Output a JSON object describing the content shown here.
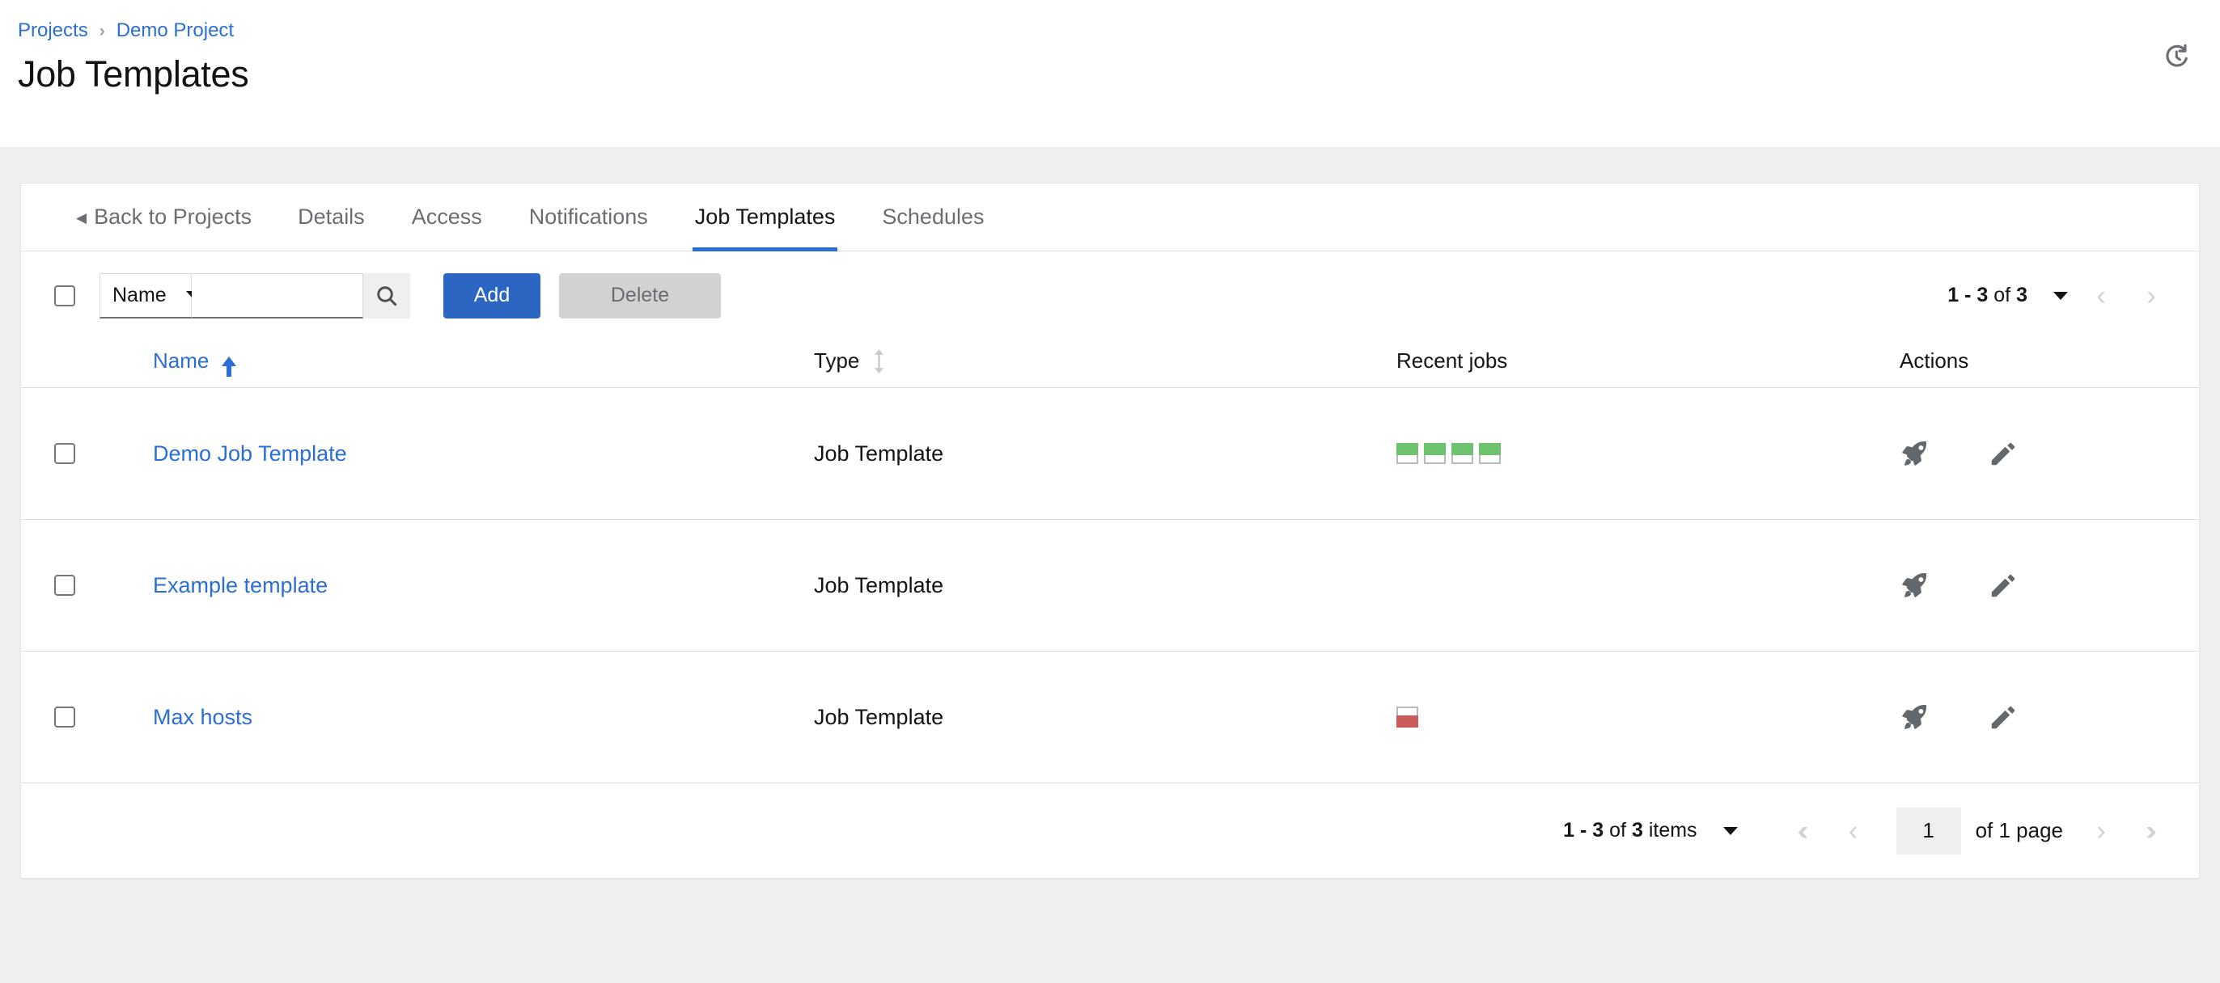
{
  "header": {
    "breadcrumb": [
      {
        "label": "Projects",
        "icon": ""
      },
      {
        "label": "Demo Project",
        "icon": ""
      }
    ],
    "breadcrumb_separator": "›",
    "title": "Job Templates",
    "history_icon": "history-icon"
  },
  "tabs": [
    {
      "label": "Back to Projects",
      "icon": "back-caret-icon",
      "active": false
    },
    {
      "label": "Details",
      "active": false
    },
    {
      "label": "Access",
      "active": false
    },
    {
      "label": "Notifications",
      "active": false
    },
    {
      "label": "Job Templates",
      "active": true
    },
    {
      "label": "Schedules",
      "active": false
    }
  ],
  "toolbar": {
    "select_all_checkbox": false,
    "search_field_label": "Name",
    "search_value": "",
    "search_placeholder": "",
    "search_icon": "search-icon",
    "add_label": "Add",
    "delete_label": "Delete",
    "delete_disabled": true,
    "pagination": {
      "count_range": "1 - 3",
      "count_of": "of",
      "count_total": "3",
      "prev_icon": "chevron-left-icon",
      "next_icon": "chevron-right-icon"
    }
  },
  "table": {
    "columns": [
      {
        "key": "name",
        "label": "Name",
        "sort": "asc"
      },
      {
        "key": "type",
        "label": "Type",
        "sort": "none"
      },
      {
        "key": "recent",
        "label": "Recent jobs",
        "sort": null
      },
      {
        "key": "actions",
        "label": "Actions",
        "sort": null
      }
    ],
    "rows": [
      {
        "checked": false,
        "name": "Demo Job Template",
        "type": "Job Template",
        "recent_jobs": [
          {
            "status": "successful",
            "color": "#6ec36e"
          },
          {
            "status": "successful",
            "color": "#6ec36e"
          },
          {
            "status": "successful",
            "color": "#6ec36e"
          },
          {
            "status": "successful",
            "color": "#6ec36e"
          }
        ],
        "actions": [
          {
            "name": "launch",
            "icon": "rocket-icon"
          },
          {
            "name": "edit",
            "icon": "pencil-icon"
          }
        ]
      },
      {
        "checked": false,
        "name": "Example template",
        "type": "Job Template",
        "recent_jobs": [],
        "actions": [
          {
            "name": "launch",
            "icon": "rocket-icon"
          },
          {
            "name": "edit",
            "icon": "pencil-icon"
          }
        ]
      },
      {
        "checked": false,
        "name": "Max hosts",
        "type": "Job Template",
        "recent_jobs": [
          {
            "status": "failed",
            "color": "#cc5c5c"
          }
        ],
        "actions": [
          {
            "name": "launch",
            "icon": "rocket-icon"
          },
          {
            "name": "edit",
            "icon": "pencil-icon"
          }
        ]
      }
    ]
  },
  "footer": {
    "count_range": "1 - 3",
    "count_of": "of",
    "count_total": "3",
    "count_items": "items",
    "first_icon": "chevron-double-left-icon",
    "prev_icon": "chevron-left-icon",
    "page_value": "1",
    "of_pages": "of 1 page",
    "next_icon": "chevron-right-icon",
    "last_icon": "chevron-double-right-icon"
  },
  "colors": {
    "accent": "#2b6fd4",
    "primary_button": "#2a66c2",
    "success": "#6ec36e",
    "danger": "#cc5c5c",
    "page_background": "#efeff0",
    "icon_gray": "#6a6e73",
    "disabled_gray": "#d2d2d2"
  }
}
